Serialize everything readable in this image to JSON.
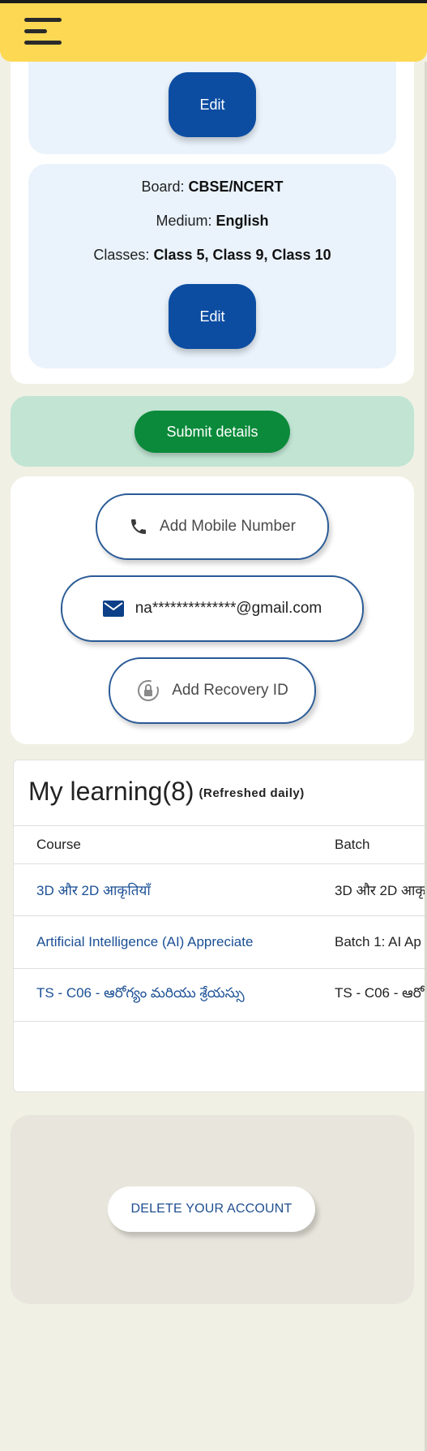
{
  "header": {
    "menu_icon": "hamburger-menu-icon",
    "background_color": "#fdd853"
  },
  "profile": {
    "edit_label_top": "Edit",
    "board_label": "Board: ",
    "board_value": "CBSE/NCERT",
    "medium_label": "Medium: ",
    "medium_value": "English",
    "classes_label": "Classes: ",
    "classes_value": "Class 5, Class 9, Class 10",
    "edit_label_bottom": "Edit"
  },
  "submit": {
    "label": "Submit details",
    "color": "#0a8a3a"
  },
  "contact": {
    "mobile_label": "Add Mobile Number",
    "mobile_icon": "phone-icon",
    "email_value": "na**************@gmail.com",
    "email_icon": "mail-icon",
    "recovery_label": "Add Recovery ID",
    "recovery_icon": "recovery-lock-icon"
  },
  "learning": {
    "title": "My learning(8)",
    "subtitle": "(Refreshed daily)",
    "columns": [
      "Course",
      "Batch"
    ],
    "rows": [
      {
        "course": "3D और 2D आकृतियाँ",
        "batch": "3D और 2D आकृ"
      },
      {
        "course": "Artificial Intelligence (AI) Appreciate",
        "batch": "Batch 1: AI Ap"
      },
      {
        "course": "TS - C06 - ఆరోగ్యం మరియు శ్రేయస్సు",
        "batch": "TS - C06 - ఆరో"
      }
    ]
  },
  "account": {
    "delete_label": "DELETE YOUR ACCOUNT"
  }
}
